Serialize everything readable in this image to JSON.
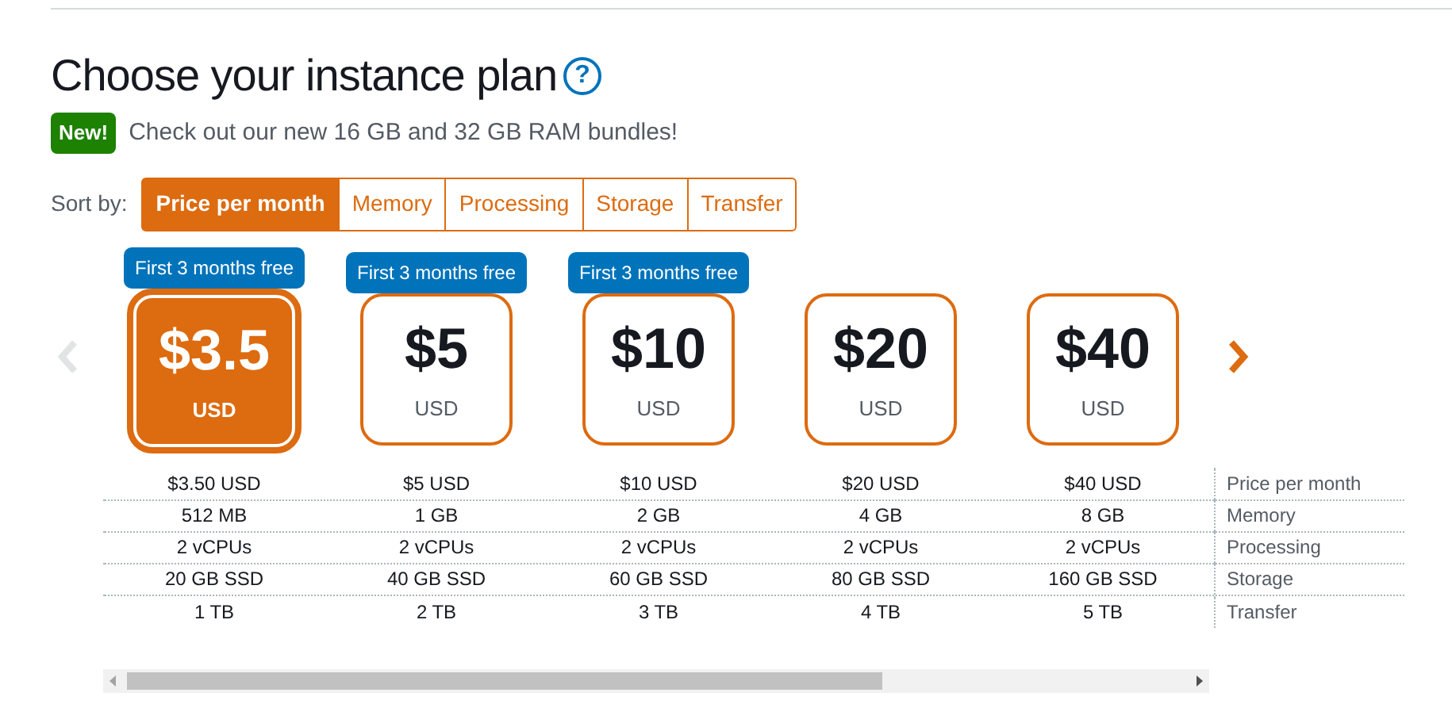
{
  "title": "Choose your instance plan",
  "help_icon": "?",
  "announcement": {
    "badge": "New!",
    "text": "Check out our new 16 GB and 32 GB RAM bundles!"
  },
  "sort": {
    "label": "Sort by:",
    "options": [
      {
        "label": "Price per month",
        "selected": true
      },
      {
        "label": "Memory",
        "selected": false
      },
      {
        "label": "Processing",
        "selected": false
      },
      {
        "label": "Storage",
        "selected": false
      },
      {
        "label": "Transfer",
        "selected": false
      }
    ]
  },
  "plans": [
    {
      "price": "$3.5",
      "currency": "USD",
      "promo": "First 3 months free",
      "selected": true
    },
    {
      "price": "$5",
      "currency": "USD",
      "promo": "First 3 months free",
      "selected": false
    },
    {
      "price": "$10",
      "currency": "USD",
      "promo": "First 3 months free",
      "selected": false
    },
    {
      "price": "$20",
      "currency": "USD",
      "selected": false
    },
    {
      "price": "$40",
      "currency": "USD",
      "selected": false
    }
  ],
  "specs": [
    {
      "label": "Price per month",
      "values": [
        "$3.50 USD",
        "$5 USD",
        "$10 USD",
        "$20 USD",
        "$40 USD"
      ]
    },
    {
      "label": "Memory",
      "values": [
        "512 MB",
        "1 GB",
        "2 GB",
        "4 GB",
        "8 GB"
      ]
    },
    {
      "label": "Processing",
      "values": [
        "2 vCPUs",
        "2 vCPUs",
        "2 vCPUs",
        "2 vCPUs",
        "2 vCPUs"
      ]
    },
    {
      "label": "Storage",
      "values": [
        "20 GB SSD",
        "40 GB SSD",
        "60 GB SSD",
        "80 GB SSD",
        "160 GB SSD"
      ]
    },
    {
      "label": "Transfer",
      "values": [
        "1 TB",
        "2 TB",
        "3 TB",
        "4 TB",
        "5 TB"
      ]
    }
  ]
}
